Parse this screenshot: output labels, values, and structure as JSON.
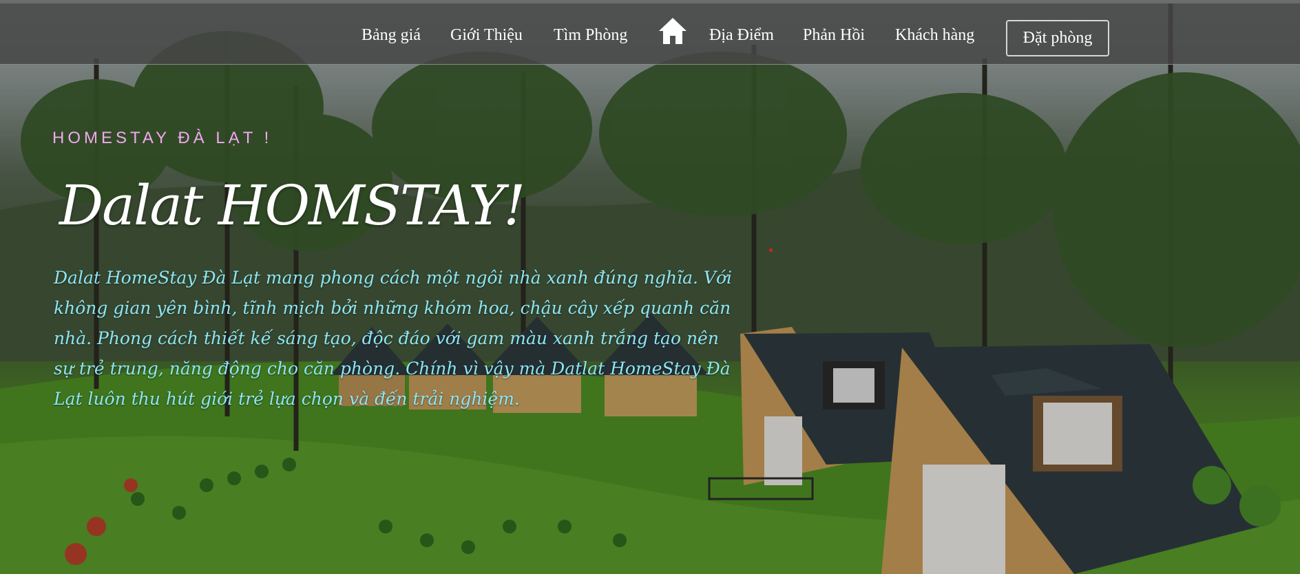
{
  "nav": {
    "items": [
      {
        "label": "Bảng giá"
      },
      {
        "label": "Giới Thiệu"
      },
      {
        "label": "Tìm Phòng"
      },
      {
        "label": "Địa Điểm"
      },
      {
        "label": "Phản Hồi"
      },
      {
        "label": "Khách hàng"
      }
    ],
    "home_icon": "home-icon",
    "book_button": "Đặt phòng"
  },
  "hero": {
    "eyebrow": "HOMESTAY ĐÀ LẠT !",
    "title": "Dalat HOMSTAY!",
    "description": "Dalat HomeStay Đà Lạt mang phong cách một ngôi nhà xanh đúng nghĩa. Với không gian yên bình, tĩnh mịch bởi những khóm hoa, chậu cây xếp quanh căn nhà. Phong cách thiết kế sáng tạo, độc đáo với gam màu xanh trắng tạo nên sự trẻ trung, năng động cho căn phòng. Chính vì vậy mà Datlat HomeStay Đà Lạt luôn thu hút giới trẻ lựa chọn và đến trải nghiệm."
  },
  "colors": {
    "navbar_bg": "#464646",
    "eyebrow": "#f0a9ef",
    "description": "#8de6f4",
    "title": "#ffffff"
  }
}
